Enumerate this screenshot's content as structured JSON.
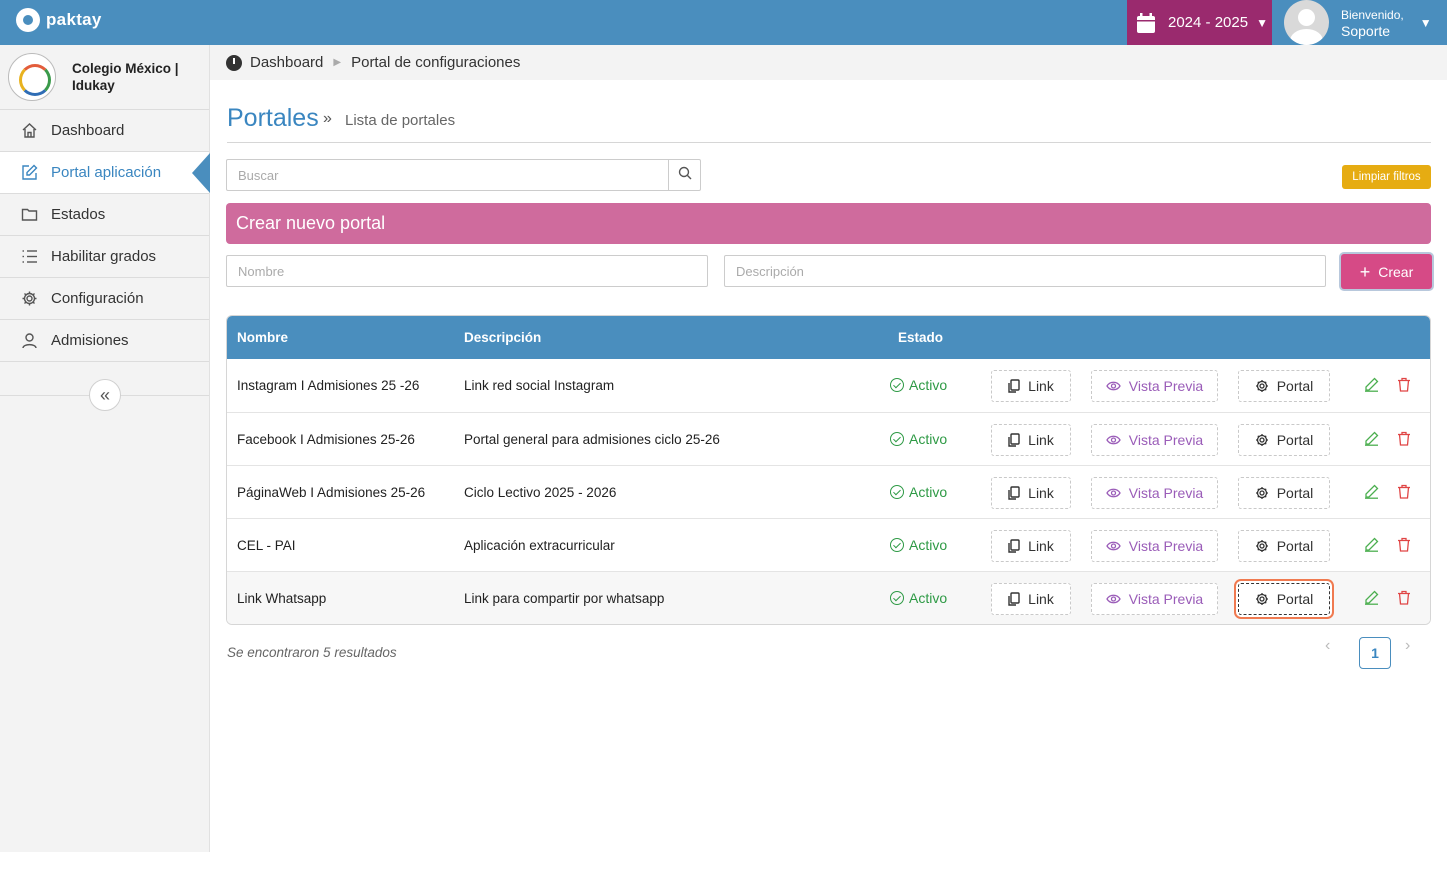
{
  "brand": {
    "name": "paktay"
  },
  "topbar": {
    "year": "2024 - 2025",
    "greeting": "Bienvenido,",
    "user": "Soporte"
  },
  "sidebar": {
    "school": "Colegio México | Idukay",
    "items": [
      {
        "label": "Dashboard",
        "icon": "home-icon"
      },
      {
        "label": "Portal aplicación",
        "icon": "edit-square-icon"
      },
      {
        "label": "Estados",
        "icon": "folder-icon"
      },
      {
        "label": "Habilitar grados",
        "icon": "list-icon"
      },
      {
        "label": "Configuración",
        "icon": "gear-icon"
      },
      {
        "label": "Admisiones",
        "icon": "user-icon"
      }
    ],
    "active_index": 1
  },
  "breadcrumb": {
    "home": "Dashboard",
    "current": "Portal de configuraciones"
  },
  "page": {
    "title": "Portales",
    "subtitle": "Lista de portales"
  },
  "search": {
    "placeholder": "Buscar",
    "clear_label": "Limpiar filtros"
  },
  "create": {
    "title": "Crear nuevo portal",
    "name_placeholder": "Nombre",
    "desc_placeholder": "Descripción",
    "button_label": "Crear"
  },
  "table": {
    "columns": [
      "Nombre",
      "Descripción",
      "Estado"
    ],
    "rows": [
      {
        "name": "Instagram I Admisiones 25 -26",
        "description": "Link red social Instagram",
        "status": "Activo"
      },
      {
        "name": "Facebook I Admisiones 25-26",
        "description": "Portal general para admisiones ciclo 25-26",
        "status": "Activo"
      },
      {
        "name": "PáginaWeb I Admisiones 25-26",
        "description": "Ciclo Lectivo 2025 - 2026",
        "status": "Activo"
      },
      {
        "name": "CEL - PAI",
        "description": "Aplicación extracurricular",
        "status": "Activo"
      },
      {
        "name": "Link Whatsapp",
        "description": "Link para compartir por whatsapp",
        "status": "Activo"
      }
    ],
    "actions": {
      "link": "Link",
      "preview": "Vista Previa",
      "portal": "Portal"
    }
  },
  "footer": {
    "results": "Se encontraron 5 resultados",
    "page": "1"
  },
  "colors": {
    "topbar": "#4a8ebe",
    "year_badge": "#9a2a6e",
    "create_banner": "#cf6b9d",
    "create_button": "#d64a86",
    "clear_button": "#e6ac12",
    "status": "#2e9a45"
  }
}
